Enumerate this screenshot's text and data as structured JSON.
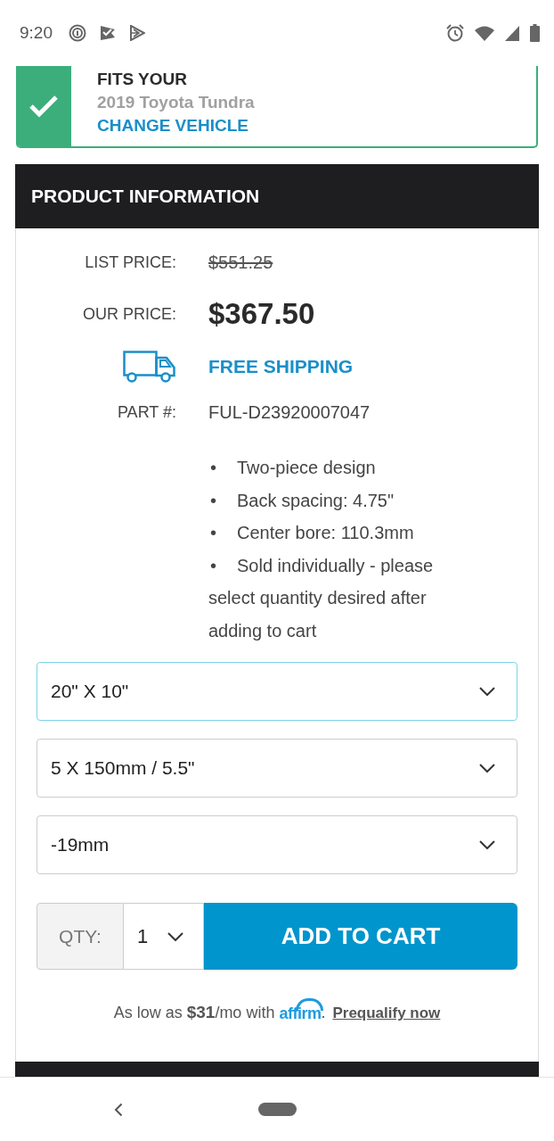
{
  "status_bar": {
    "time": "9:20"
  },
  "fitment": {
    "heading": "FITS YOUR",
    "vehicle": "2019 Toyota Tundra",
    "link": "CHANGE VEHICLE"
  },
  "product_info": {
    "title": "PRODUCT INFORMATION",
    "rows": [
      {
        "kind": "list_price",
        "label": "LIST PRICE:",
        "value": "$551.25"
      },
      {
        "kind": "our_price",
        "label": "OUR PRICE:",
        "value": "$367.50"
      },
      {
        "kind": "shipping",
        "value": "FREE SHIPPING"
      },
      {
        "kind": "part",
        "label": "PART #:",
        "value": "FUL-D23920007047"
      }
    ],
    "features": [
      {
        "bullet": "•",
        "text": "Two-piece design"
      },
      {
        "bullet": "•",
        "text": "Back spacing: 4.75\""
      },
      {
        "bullet": "•",
        "text": "Center bore: 110.3mm"
      },
      {
        "bullet": "•",
        "text": "Sold individually - please select quantity desired after adding to cart"
      }
    ],
    "options": [
      {
        "value": "20\" X 10\"",
        "focused": true
      },
      {
        "value": "5 X 150mm / 5.5\"",
        "focused": false
      },
      {
        "value": "-19mm",
        "focused": false
      }
    ],
    "quantity": {
      "label": "QTY:",
      "value": "1"
    },
    "add_to_cart": "ADD TO CART",
    "financing": {
      "text": "As low as **$31**/mo with",
      "logo": "affirm",
      "after_logo": ".",
      "link": "Prequalify now"
    }
  }
}
